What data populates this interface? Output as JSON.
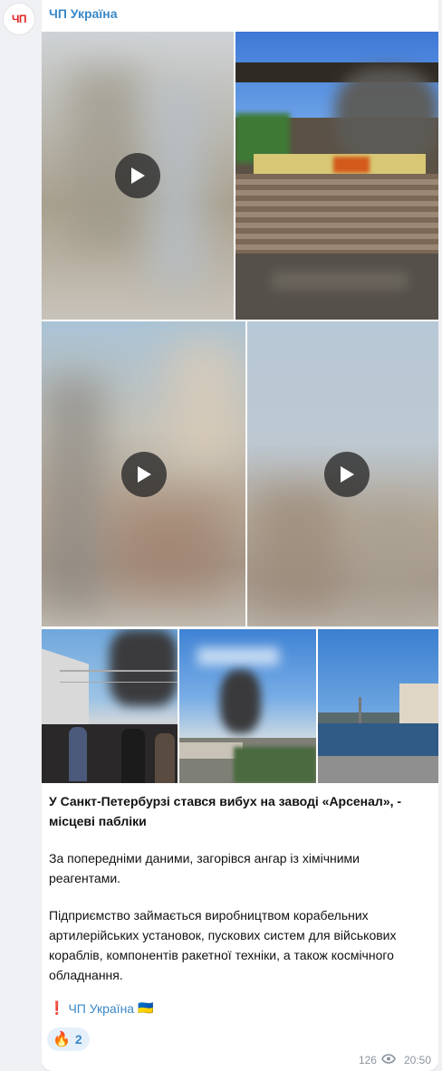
{
  "channel": {
    "name": "ЧП Україна",
    "avatar_text": "ЧП"
  },
  "media": {
    "videos": [
      "video-1",
      "video-2",
      "video-3",
      "video-4"
    ],
    "photos": [
      "photo-1",
      "photo-2",
      "photo-3"
    ]
  },
  "post": {
    "title": "У Санкт-Петербурзі стався вибух на заводі «Арсенал», - місцеві пабліки",
    "paragraph_1": "За попередніми даними, загорівся ангар із хімічними реагентами.",
    "paragraph_2": "Підприємство займається виробництвом корабельних артилерійських установок, пускових систем для військових кораблів, компонентів ракетної техніки, а також космічного обладнання.",
    "signature_prefix": "❗",
    "signature_link": "ЧП Україна",
    "signature_flag": "🇺🇦"
  },
  "reactions": [
    {
      "emoji": "🔥",
      "count": "2"
    }
  ],
  "meta": {
    "views": "126",
    "time": "20:50"
  },
  "colors": {
    "link": "#3a88c8",
    "reaction_bg": "#e6f0fa",
    "meta": "#8c959e",
    "page_bg": "#f0f1f5"
  },
  "icons": {
    "play": "play-icon",
    "views": "eye-icon"
  }
}
